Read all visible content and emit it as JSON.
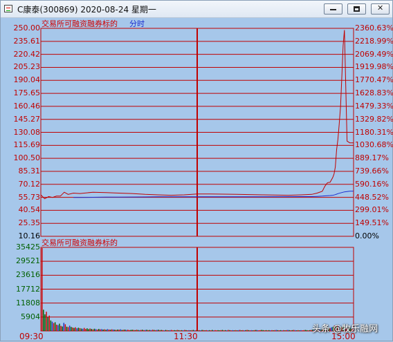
{
  "window": {
    "title": "C康泰(300869)  2020-08-24  星期一",
    "buttons": [
      "minimize",
      "maximize",
      "close"
    ]
  },
  "price_panel": {
    "label_red": "交易所可融资融券标的",
    "label_blue": "分时",
    "price_axis": [
      "250.00",
      "235.61",
      "220.42",
      "205.23",
      "190.04",
      "175.65",
      "160.46",
      "145.27",
      "130.08",
      "115.69",
      "100.50",
      "85.31",
      "70.12",
      "55.73",
      "40.54",
      "25.35",
      "10.16"
    ],
    "pct_axis": [
      "2360.63%",
      "2218.99%",
      "2069.49%",
      "1919.98%",
      "1770.47%",
      "1628.83%",
      "1479.33%",
      "1329.82%",
      "1180.31%",
      "1030.68%",
      "889.17%",
      "739.66%",
      "590.16%",
      "448.52%",
      "299.01%",
      "149.51%",
      "0.00%"
    ]
  },
  "volume_panel": {
    "label": "交易所可融资融券标的",
    "volume_axis": [
      "35425",
      "29521",
      "23616",
      "17712",
      "11808",
      "5904"
    ]
  },
  "time_axis": [
    "09:30",
    "11:30",
    "15:00"
  ],
  "watermark": "头条 @牧乐融网",
  "colors": {
    "background": "#a6c7ea",
    "grid": "#c00000",
    "price_line": "#c00000",
    "avg_line": "#1a2dd0",
    "axis_green": "#006000",
    "volume_bar_red": "#d00000",
    "volume_bar_green": "#006000",
    "volume_bar_blue": "#2030c0"
  },
  "chart_data": [
    {
      "type": "line",
      "title": "",
      "xlabel": "",
      "ylabel": "",
      "x": [
        "09:30",
        "09:33",
        "09:36",
        "09:39",
        "09:42",
        "09:45",
        "09:48",
        "09:51",
        "09:55",
        "10:00",
        "10:10",
        "10:20",
        "10:30",
        "10:40",
        "10:50",
        "11:00",
        "11:10",
        "11:20",
        "11:30",
        "13:10",
        "13:30",
        "13:50",
        "14:10",
        "14:20",
        "14:28",
        "14:32",
        "14:36",
        "14:38",
        "14:40",
        "14:42",
        "14:44",
        "14:45",
        "14:46",
        "14:47",
        "14:48",
        "14:49",
        "14:50",
        "14:51",
        "14:52",
        "14:53",
        "14:55",
        "14:57",
        "15:00"
      ],
      "series": [
        {
          "values": [
            58.0,
            53.5,
            56.0,
            55.0,
            56.5,
            56.5,
            61.0,
            58.5,
            60.0,
            59.5,
            61.0,
            60.5,
            60.0,
            59.5,
            58.5,
            58.0,
            57.5,
            58.0,
            59.0,
            59.0,
            58.5,
            58.0,
            57.5,
            58.0,
            58.5,
            60.0,
            62.0,
            68.0,
            72.0,
            72.5,
            78.0,
            82.0,
            90.0,
            110.0,
            122.0,
            140.0,
            160.0,
            195.0,
            230.0,
            248.0,
            120.0,
            118.0,
            118.0
          ]
        },
        {
          "values": [
            null,
            null,
            null,
            null,
            null,
            null,
            null,
            null,
            55.0,
            55.0,
            55.2,
            55.3,
            55.4,
            55.5,
            55.6,
            55.7,
            55.7,
            55.7,
            55.8,
            55.8,
            55.8,
            55.8,
            55.9,
            56.0,
            56.0,
            56.2,
            56.5,
            56.8,
            57.0,
            57.2,
            57.5,
            57.8,
            58.2,
            58.8,
            59.3,
            59.8,
            60.2,
            60.6,
            61.0,
            61.4,
            61.8,
            62.1,
            62.3
          ]
        }
      ],
      "ylim": [
        10.16,
        250.0
      ]
    },
    {
      "type": "bar",
      "title": "",
      "ylim": [
        0,
        41329
      ],
      "values": [
        41000,
        10500,
        8200,
        9500,
        6800,
        7600,
        5200,
        4600,
        3900,
        4300,
        3100,
        2900,
        3600,
        2500,
        2200,
        4000,
        3300,
        2100,
        1900,
        2600,
        2000,
        1700,
        1500,
        1800,
        1300,
        1600,
        1400,
        1200,
        1100,
        1500,
        1000,
        1300,
        900,
        1200,
        1000,
        800,
        1100,
        900,
        700,
        1000,
        800,
        900,
        700,
        800,
        600,
        900,
        700,
        600,
        800,
        700,
        600,
        500,
        700,
        600,
        800,
        500,
        600,
        700,
        500,
        600,
        400,
        500,
        600,
        500,
        400,
        600,
        500,
        400,
        500,
        600,
        400,
        500,
        600,
        400,
        500,
        400,
        600,
        500,
        400,
        500,
        600,
        400,
        500,
        400,
        300,
        500,
        400,
        300,
        400,
        500,
        300,
        400,
        300,
        500,
        400,
        300,
        400,
        300,
        500,
        400,
        300,
        400,
        300,
        400,
        500,
        300,
        400,
        300,
        400,
        300,
        500,
        400,
        300,
        400,
        300,
        400,
        300,
        500,
        300,
        400,
        300,
        400,
        300,
        400,
        500,
        300,
        400,
        300,
        500,
        400,
        300,
        400,
        300,
        400,
        300,
        400,
        500,
        300,
        400,
        300,
        400,
        500,
        400,
        300,
        400,
        300,
        400,
        500,
        400,
        300,
        400,
        500,
        400,
        300,
        400,
        300,
        400,
        300,
        400,
        300,
        400,
        500,
        400,
        300,
        400,
        300,
        400,
        300,
        400,
        500,
        400,
        300,
        400,
        500,
        400,
        300,
        400,
        300,
        400,
        300,
        400,
        500,
        400,
        300,
        400,
        500,
        600,
        400,
        500,
        600,
        500,
        700,
        600,
        800,
        900,
        1200,
        1000,
        1500,
        1300,
        1800,
        2000,
        2600,
        2300,
        2900,
        2200,
        1600,
        1800,
        2400,
        1500,
        1200,
        1400,
        1800,
        1300,
        1000
      ],
      "bar_colors": [
        "r",
        "g",
        "g",
        "r",
        "g",
        "r",
        "g",
        "b",
        "r",
        "g",
        "r",
        "b",
        "g",
        "r",
        "g",
        "b",
        "r",
        "g",
        "r",
        "b",
        "g",
        "r",
        "g",
        "r",
        "b",
        "g",
        "r",
        "g",
        "b",
        "r"
      ]
    }
  ]
}
